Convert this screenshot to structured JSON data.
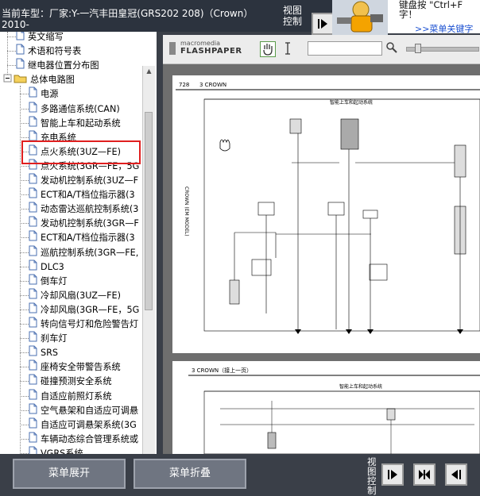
{
  "title": {
    "line1": "当前车型：厂家:Y-一汽丰田皇冠(GRS202 208)（Crown）",
    "line2": "2010-"
  },
  "view_control": {
    "label": "视图控制"
  },
  "hint": {
    "line1": "键盘按 \"Ctrl+F",
    "line1b": "字！",
    "link": ">>菜单关键字"
  },
  "tree": {
    "items": [
      {
        "label": "英文缩写",
        "indent": 1,
        "type": "doc"
      },
      {
        "label": "术语和符号表",
        "indent": 1,
        "type": "doc"
      },
      {
        "label": "继电器位置分布图",
        "indent": 1,
        "type": "doc"
      },
      {
        "label": "总体电路图",
        "indent": 0,
        "type": "folder"
      },
      {
        "label": "电源",
        "indent": 2,
        "type": "doc"
      },
      {
        "label": "多路通信系统(CAN)",
        "indent": 2,
        "type": "doc"
      },
      {
        "label": "智能上车和起动系统",
        "indent": 2,
        "type": "doc",
        "selected": true
      },
      {
        "label": "充电系统",
        "indent": 2,
        "type": "doc"
      },
      {
        "label": "点火系统(3UZ—FE)",
        "indent": 2,
        "type": "doc"
      },
      {
        "label": "点火系统(3GR—FE，5G",
        "indent": 2,
        "type": "doc"
      },
      {
        "label": "发动机控制系统(3UZ—F",
        "indent": 2,
        "type": "doc"
      },
      {
        "label": "ECT和A/T档位指示器(3",
        "indent": 2,
        "type": "doc"
      },
      {
        "label": "动态雷达巡航控制系统(3",
        "indent": 2,
        "type": "doc"
      },
      {
        "label": "发动机控制系统(3GR—F",
        "indent": 2,
        "type": "doc"
      },
      {
        "label": "ECT和A/T档位指示器(3",
        "indent": 2,
        "type": "doc"
      },
      {
        "label": "巡航控制系统(3GR—FE,",
        "indent": 2,
        "type": "doc"
      },
      {
        "label": "DLC3",
        "indent": 2,
        "type": "doc"
      },
      {
        "label": "倒车灯",
        "indent": 2,
        "type": "doc"
      },
      {
        "label": "冷却风扇(3UZ—FE)",
        "indent": 2,
        "type": "doc"
      },
      {
        "label": "冷却风扇(3GR—FE，5G",
        "indent": 2,
        "type": "doc"
      },
      {
        "label": "转向信号灯和危险警告灯",
        "indent": 2,
        "type": "doc"
      },
      {
        "label": "刹车灯",
        "indent": 2,
        "type": "doc"
      },
      {
        "label": "SRS",
        "indent": 2,
        "type": "doc"
      },
      {
        "label": "座椅安全带警告系统",
        "indent": 2,
        "type": "doc"
      },
      {
        "label": "碰撞预测安全系统",
        "indent": 2,
        "type": "doc"
      },
      {
        "label": "自适应前照灯系统",
        "indent": 2,
        "type": "doc"
      },
      {
        "label": "空气悬架和自适应可调悬",
        "indent": 2,
        "type": "doc"
      },
      {
        "label": "自适应可调悬架系统(3G",
        "indent": 2,
        "type": "doc"
      },
      {
        "label": "车辆动态综合管理系统或",
        "indent": 2,
        "type": "doc"
      },
      {
        "label": "VGRS系统",
        "indent": 2,
        "type": "doc"
      }
    ]
  },
  "viewer": {
    "logo_top": "macromedia",
    "logo_bottom": "FLASHPAPER",
    "page1_header": "3 CROWN",
    "page1_side": "CROWN (EM MODEL)",
    "page1_number": "728",
    "page1_diagram_title": "智能上车和起动系统",
    "page2_header": "3 CROWN（接上一页）",
    "page2_diagram_title": "智能上车和起动系统"
  },
  "bottom": {
    "expand_label": "菜单展开",
    "collapse_label": "菜单折叠",
    "view_label": "视图控制"
  },
  "colors": {
    "titlebar": "#2c333e",
    "highlight": "#e01f1f",
    "link": "#1a4fd0"
  }
}
